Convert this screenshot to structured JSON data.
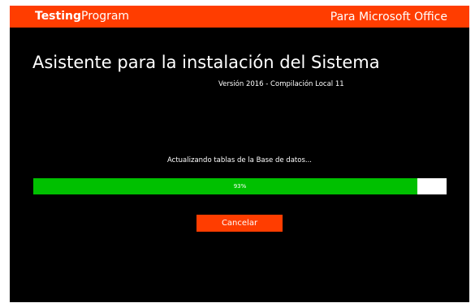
{
  "header": {
    "brand_bold": "Testing",
    "brand_light": "Program",
    "product": "Para Microsoft Office"
  },
  "main": {
    "title": "Asistente para la instalación del Sistema",
    "version": "Versión 2016 - Compilación Local 11",
    "status": "Actualizando tablas de la Base de datos...",
    "progress_percent": 93,
    "progress_label": "93%",
    "cancel_label": "Cancelar"
  },
  "colors": {
    "accent": "#ff3d00",
    "background": "#000000",
    "progress_fill": "#00c000",
    "progress_track": "#ffffff"
  }
}
